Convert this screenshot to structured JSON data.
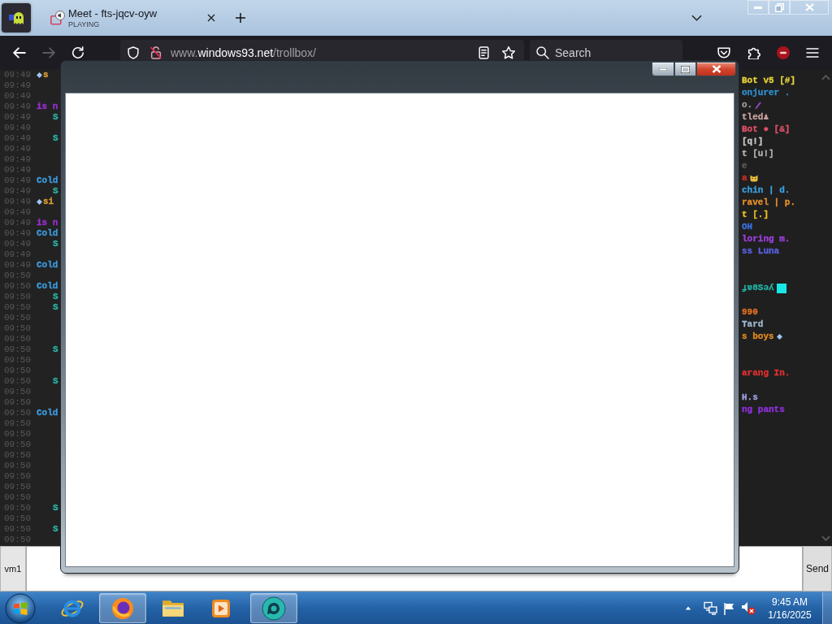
{
  "browser": {
    "tabs": [
      {
        "kind": "pinned",
        "selected": true
      },
      {
        "kind": "media",
        "title": "Meet - fts-jqcv-oyw",
        "status": "PLAYING",
        "selected": false
      }
    ],
    "nav": {
      "back": {
        "disabled": false
      },
      "forward": {
        "disabled": true
      }
    },
    "address_bar": {
      "url": "www.windows93.net/trollbox/"
    },
    "search": {
      "placeholder": "Search"
    }
  },
  "chat": {
    "messages": [
      {
        "time": "09:49",
        "kind": "nick",
        "text": "s",
        "color": "#e0a030",
        "badge": {
          "kind": "diamond"
        }
      },
      {
        "time": "09:49"
      },
      {
        "time": "09:49"
      },
      {
        "time": "09:49",
        "kind": "nick",
        "text": "is n",
        "color": "#9a2fd6"
      },
      {
        "time": "09:49",
        "kind": "body",
        "text": "S",
        "color": "#2ab3a3"
      },
      {
        "time": "09:49"
      },
      {
        "time": "09:49",
        "kind": "body",
        "text": "S",
        "color": "#2ab3a3"
      },
      {
        "time": "09:49"
      },
      {
        "time": "09:49"
      },
      {
        "time": "09:49"
      },
      {
        "time": "09:49",
        "kind": "nick",
        "text": "Cold",
        "color": "#3c9be0"
      },
      {
        "time": "09:49",
        "kind": "body",
        "text": "S",
        "color": "#2ab3a3"
      },
      {
        "time": "09:49",
        "kind": "nick",
        "text": "si",
        "color": "#e0a030",
        "badge": {
          "kind": "diamond"
        }
      },
      {
        "time": "09:49"
      },
      {
        "time": "09:49",
        "kind": "nick",
        "text": "is n",
        "color": "#9a2fd6"
      },
      {
        "time": "09:49",
        "kind": "nick",
        "text": "Cold",
        "color": "#3c9be0"
      },
      {
        "time": "09:49",
        "kind": "body",
        "text": "S",
        "color": "#2ab3a3"
      },
      {
        "time": "09:49"
      },
      {
        "time": "09:49",
        "kind": "nick",
        "text": "Cold",
        "color": "#3c9be0"
      },
      {
        "time": "09:50"
      },
      {
        "time": "09:50",
        "kind": "nick",
        "text": "Cold",
        "color": "#3c9be0"
      },
      {
        "time": "09:50",
        "kind": "body",
        "text": "S",
        "color": "#2ab3a3"
      },
      {
        "time": "09:50",
        "kind": "body",
        "text": "S",
        "color": "#2ab3a3"
      },
      {
        "time": "09:50"
      },
      {
        "time": "09:50"
      },
      {
        "time": "09:50"
      },
      {
        "time": "09:50",
        "kind": "body",
        "text": "S",
        "color": "#2ab3a3"
      },
      {
        "time": "09:50"
      },
      {
        "time": "09:50"
      },
      {
        "time": "09:50",
        "kind": "body",
        "text": "S",
        "color": "#2ab3a3"
      },
      {
        "time": "09:50"
      },
      {
        "time": "09:50"
      },
      {
        "time": "09:50",
        "kind": "nick",
        "text": "Cold",
        "color": "#3c9be0"
      },
      {
        "time": "09:50"
      },
      {
        "time": "09:50"
      },
      {
        "time": "09:50"
      },
      {
        "time": "09:50"
      },
      {
        "time": "09:50"
      },
      {
        "time": "09:50"
      },
      {
        "time": "09:50"
      },
      {
        "time": "09:50"
      },
      {
        "time": "09:50",
        "kind": "body",
        "text": "S",
        "color": "#2ab3a3"
      },
      {
        "time": "09:50"
      },
      {
        "time": "09:50",
        "kind": "body",
        "text": "S",
        "color": "#2ab3a3"
      },
      {
        "time": "09:50"
      }
    ],
    "users": [
      {
        "kind": "name",
        "name": "Bot v5 [#]",
        "color": "#e6d23a"
      },
      {
        "kind": "name",
        "name": "onjurer .",
        "color": "#2f8fd0"
      },
      {
        "kind": "name",
        "name": "o.",
        "color": "#9a9a9a",
        "badge": {
          "kind": "pencil"
        }
      },
      {
        "kind": "name",
        "name": "tled♟",
        "color": "#caa0a0"
      },
      {
        "kind": "name",
        "name": "Bot ● [&]",
        "color": "#e0506a"
      },
      {
        "kind": "name",
        "name": "[q!]",
        "color": "#c8c8c8"
      },
      {
        "kind": "name",
        "name": "t [u!]",
        "color": "#b4b4b4"
      },
      {
        "kind": "name",
        "name": "e",
        "color": "#5c5c5c"
      },
      {
        "kind": "name",
        "name": "a",
        "color": "#d02c2c",
        "badge": {
          "kind": "cat"
        }
      },
      {
        "kind": "name",
        "name": "chin | d.",
        "color": "#3aa0e0"
      },
      {
        "kind": "name",
        "name": "ravel | p.",
        "color": "#e8902a"
      },
      {
        "kind": "name",
        "name": "t [.]",
        "color": "#e8c020"
      },
      {
        "kind": "name",
        "name": "OH",
        "color": "#3a70e0"
      },
      {
        "kind": "name",
        "name": "loring m.",
        "color": "#a040e0"
      },
      {
        "kind": "name",
        "name": "ss Luna",
        "color": "#5a62e0"
      },
      {
        "kind": "blank"
      },
      {
        "kind": "blank"
      },
      {
        "kind": "name",
        "name": "ɟɐ8Sǝʎ",
        "color": "#20b0a0",
        "badge": {
          "kind": "square"
        }
      },
      {
        "kind": "blank"
      },
      {
        "kind": "name",
        "name": "990",
        "color": "#e07020"
      },
      {
        "kind": "name",
        "name": "Tard",
        "color": "#a0b8d0"
      },
      {
        "kind": "name",
        "name": "s boys",
        "color": "#e08a20",
        "badge": {
          "kind": "diamond"
        }
      },
      {
        "kind": "blank"
      },
      {
        "kind": "blank"
      },
      {
        "kind": "name",
        "name": "arang In.",
        "color": "#e03030"
      },
      {
        "kind": "blank"
      },
      {
        "kind": "name",
        "name": "H.s",
        "color": "#a0a0e0"
      },
      {
        "kind": "name",
        "name": "ng pants",
        "color": "#9030e0"
      }
    ]
  },
  "input_bar": {
    "nick_button": "vm1",
    "send_button": "Send"
  },
  "taskbar": {
    "apps": [
      {
        "kind": "ie",
        "active": false
      },
      {
        "kind": "firefox",
        "active": true
      },
      {
        "kind": "folder",
        "active": false
      },
      {
        "kind": "player",
        "active": false
      },
      {
        "kind": "meet",
        "active": true
      }
    ],
    "tray": {
      "volume_muted": true
    },
    "clock": {
      "time": "9:45 AM",
      "date": "1/16/2025"
    }
  }
}
